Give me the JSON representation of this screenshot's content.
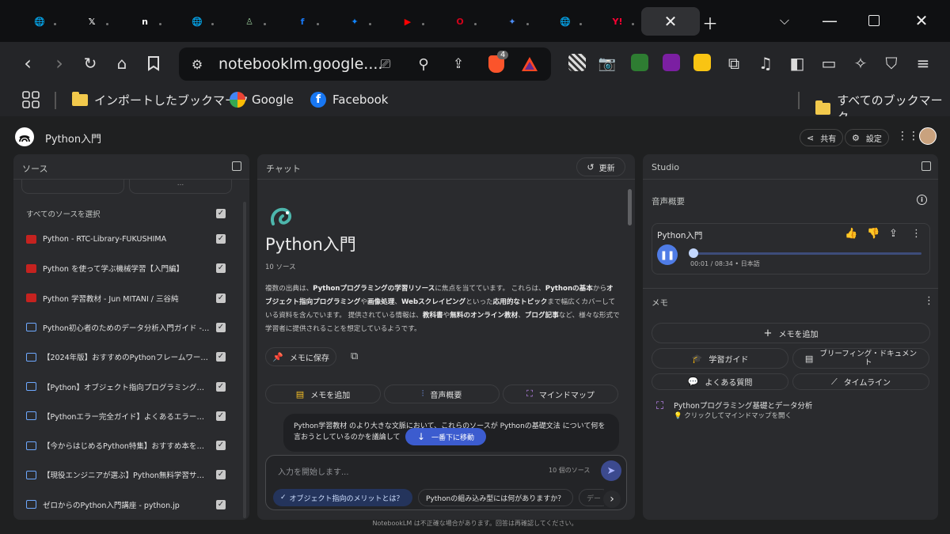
{
  "browser": {
    "tabs": [
      {
        "icon": "globe-icon",
        "color": "#9aa0a6",
        "glyph": "🌐"
      },
      {
        "icon": "x-icon",
        "color": "#ffffff",
        "glyph": "𝕏"
      },
      {
        "icon": "note-icon",
        "color": "#ffffff",
        "glyph": "n"
      },
      {
        "icon": "globe-icon",
        "color": "#9aa0a6",
        "glyph": "🌐"
      },
      {
        "icon": "bottle-icon",
        "color": "#8fbc8f",
        "glyph": "♙"
      },
      {
        "icon": "facebook-icon",
        "color": "#1877f2",
        "glyph": "f"
      },
      {
        "icon": "bluesky-icon",
        "color": "#1185fe",
        "glyph": "✦"
      },
      {
        "icon": "youtube-icon",
        "color": "#ff0000",
        "glyph": "▶"
      },
      {
        "icon": "opera-icon",
        "color": "#d0021b",
        "glyph": "O"
      },
      {
        "icon": "gemini-icon",
        "color": "#4c8df6",
        "glyph": "✦"
      },
      {
        "icon": "globe-icon",
        "color": "#9aa0a6",
        "glyph": "🌐"
      },
      {
        "icon": "yahoo-icon",
        "color": "#ff0033",
        "glyph": "Y!"
      }
    ],
    "url": "notebooklm.google....",
    "brave_badge": "4",
    "bookmarks": {
      "imported": "インポートしたブックマーク",
      "google": "Google",
      "facebook": "Facebook",
      "all": "すべてのブックマーク"
    }
  },
  "app": {
    "title": "Python入門",
    "share": "共有",
    "settings": "設定"
  },
  "sources": {
    "header": "ソース",
    "select_all": "すべてのソースを選択",
    "partial": "...",
    "items": [
      {
        "type": "pdf",
        "label": "Python - RTC-Library-FUKUSHIMA"
      },
      {
        "type": "pdf",
        "label": "Python を使って学ぶ機械学習【入門編】"
      },
      {
        "type": "pdf",
        "label": "Python 学習教材 - Jun MITANI / 三谷純"
      },
      {
        "type": "web",
        "label": "Python初心者のためのデータ分析入門ガイド - Q..."
      },
      {
        "type": "web",
        "label": "【2024年版】おすすめのPythonフレームワーク..."
      },
      {
        "type": "web",
        "label": "【Python】オブジェクト指向プログラミングの..."
      },
      {
        "type": "web",
        "label": "【Pythonエラー完全ガイド】よくあるエラーと..."
      },
      {
        "type": "web",
        "label": "【今からはじめるPython特集】おすすめ本をレ..."
      },
      {
        "type": "web",
        "label": "【現役エンジニアが選ぶ】Python無料学習サイ..."
      },
      {
        "type": "web",
        "label": "ゼロからのPython入門講座 - python.jp"
      }
    ]
  },
  "chat": {
    "header": "チャット",
    "refresh": "更新",
    "notebook_title": "Python入門",
    "source_count": "10 ソース",
    "summary_parts": [
      "複数の出典は、",
      "Pythonプログラミングの学習リソース",
      "に焦点を当てています。 これらは、",
      "Pythonの基本",
      "から",
      "オブジェクト指向プログラミング",
      "や",
      "画像処理",
      "、",
      "Webスクレイピング",
      "といった",
      "応用的なトピック",
      "まで幅広くカバーしている資料を含んでいます。 提供されている情報は、",
      "教科書",
      "や",
      "無料のオンライン教材",
      "、",
      "ブログ記事",
      "など、様々な形式で学習者に提供されることを想定しているようです。"
    ],
    "save_memo": "メモに保存",
    "add_memo": "メモを追加",
    "audio_overview": "音声概要",
    "mind_map": "マインドマップ",
    "bubble_text": "Python学習教材 のより大きな文脈において、これらのソースが Pythonの基礎文法 について何を言おうとしているのかを議論して",
    "scroll_bottom": "一番下に移動",
    "input_placeholder": "入力を開始します...",
    "input_sources": "10 個のソース",
    "suggestions": [
      "オブジェクト指向のメリットとは？",
      "Pythonの組み込み型には何がありますか？",
      "デー"
    ],
    "footer": "NotebookLM は不正確な場合があります。回答は再確認してください。"
  },
  "studio": {
    "header": "Studio",
    "audio_label": "音声概要",
    "player_title": "Python入門",
    "time": "00:01 / 08:34 • 日本語",
    "progress": 0.002,
    "memo_label": "メモ",
    "add_memo": "メモを追加",
    "study_guide": "学習ガイド",
    "briefing": "ブリーフィング・ドキュメン\nト",
    "faq": "よくある質問",
    "timeline": "タイムライン",
    "mindmap_title": "Pythonプログラミング基礎とデータ分析",
    "mindmap_sub": "クリックしてマインドマップを開く"
  }
}
